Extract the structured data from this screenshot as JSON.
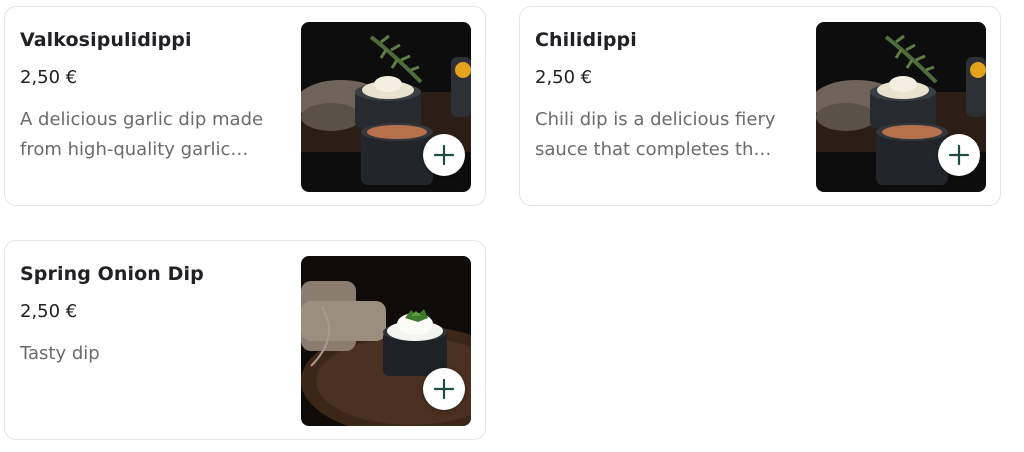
{
  "items": [
    {
      "title": "Valkosipulidippi",
      "price": "2,50 €",
      "description": "A delicious garlic dip made from high-quality garlic…",
      "add_icon": "plus-icon"
    },
    {
      "title": "Chilidippi",
      "price": "2,50 €",
      "description": "Chili dip is a delicious fiery sauce that completes th…",
      "add_icon": "plus-icon"
    },
    {
      "title": "Spring Onion Dip",
      "price": "2,50 €",
      "description": "Tasty dip",
      "add_icon": "plus-icon"
    }
  ],
  "colors": {
    "accent": "#1f4d45",
    "title": "#202125",
    "description": "#6b6b6b",
    "border": "#e4e6e6"
  }
}
